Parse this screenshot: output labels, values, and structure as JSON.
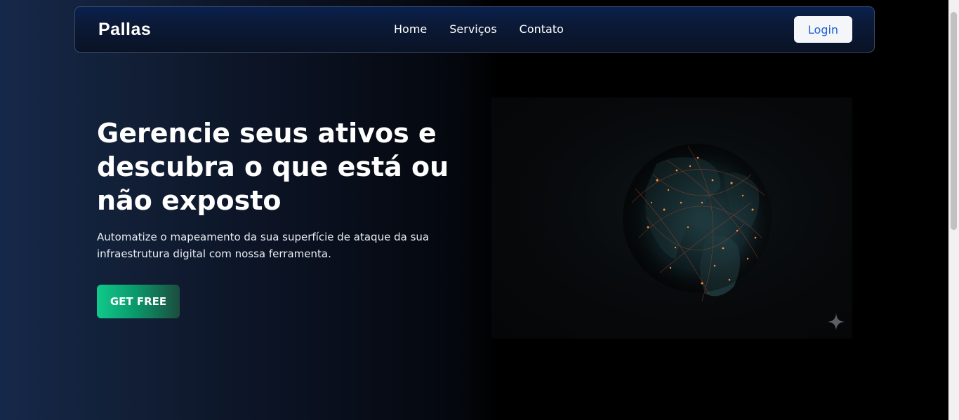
{
  "navbar": {
    "logo": "Pallas",
    "links": [
      {
        "label": "Home"
      },
      {
        "label": "Serviços"
      },
      {
        "label": "Contato"
      }
    ],
    "login_label": "Login"
  },
  "hero": {
    "title": "Gerencie seus ativos e descubra o que está ou não exposto",
    "subtitle": "Automatize o mapeamento da sua superfície de ataque da sua infraestrutura digital com nossa ferramenta.",
    "cta_label": "GET FREE"
  },
  "icons": {
    "sparkle": "sparkle-icon",
    "globe": "globe-network-image"
  },
  "colors": {
    "accent_green": "#10c98a",
    "login_text": "#1e5fd6",
    "navbar_bg": "#0a2150"
  }
}
